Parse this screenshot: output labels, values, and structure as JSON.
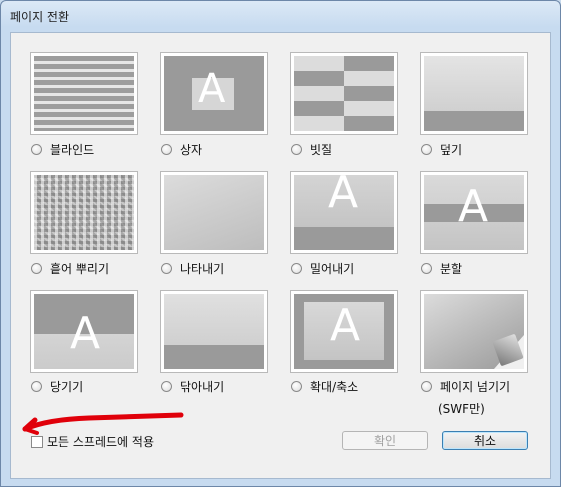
{
  "window": {
    "title": "페이지 전환"
  },
  "transitions": [
    {
      "id": "blinds",
      "label": "블라인드"
    },
    {
      "id": "box",
      "label": "상자"
    },
    {
      "id": "comb",
      "label": "빗질"
    },
    {
      "id": "cover",
      "label": "덮기"
    },
    {
      "id": "dissolve",
      "label": "흩어 뿌리기"
    },
    {
      "id": "fade",
      "label": "나타내기"
    },
    {
      "id": "push",
      "label": "밀어내기"
    },
    {
      "id": "split",
      "label": "분할"
    },
    {
      "id": "uncover",
      "label": "당기기"
    },
    {
      "id": "wipe",
      "label": "닦아내기"
    },
    {
      "id": "zoom",
      "label": "확대/축소"
    },
    {
      "id": "pageturn",
      "label": "페이지 넘기기",
      "sublabel": "(SWF만)"
    }
  ],
  "thumb_glyph": "A",
  "apply_all": {
    "label": "모든 스프레드에 적용",
    "checked": false
  },
  "buttons": {
    "ok": "확인",
    "cancel": "취소"
  },
  "colors": {
    "annotation_stroke": "#e0000a"
  }
}
